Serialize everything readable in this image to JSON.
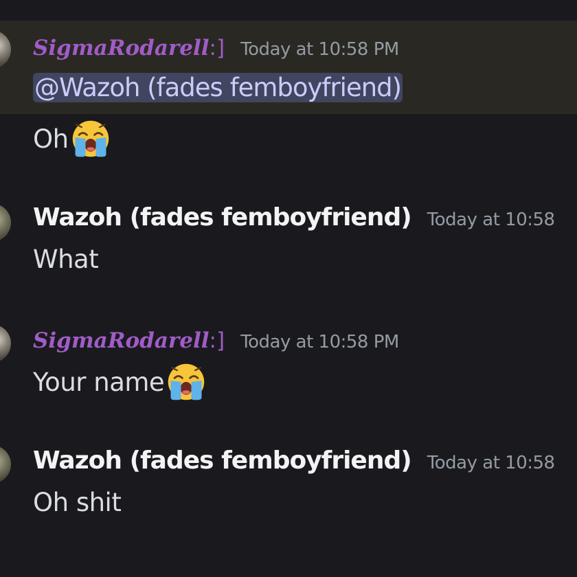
{
  "colors": {
    "background": "#1a1a1e",
    "mention_highlight": "#2a2823",
    "mention_pill": "#42455f",
    "fancy_name": "#a05cc7",
    "timestamp": "#949ba4"
  },
  "messages": [
    {
      "author": "SigmaRodarell",
      "author_suffix": ":]",
      "timestamp": "Today at 10:58 PM",
      "mention": "@Wazoh (fades femboyfriend)",
      "text": "Oh",
      "emoji": "loudly-crying-face"
    },
    {
      "author": "Wazoh (fades femboyfriend)",
      "timestamp": "Today at 10:58",
      "text": "What"
    },
    {
      "author": "SigmaRodarell",
      "author_suffix": ":]",
      "timestamp": "Today at 10:58 PM",
      "text": "Your name",
      "emoji": "loudly-crying-face"
    },
    {
      "author": "Wazoh (fades femboyfriend)",
      "timestamp": "Today at 10:58",
      "text": "Oh shit"
    }
  ]
}
